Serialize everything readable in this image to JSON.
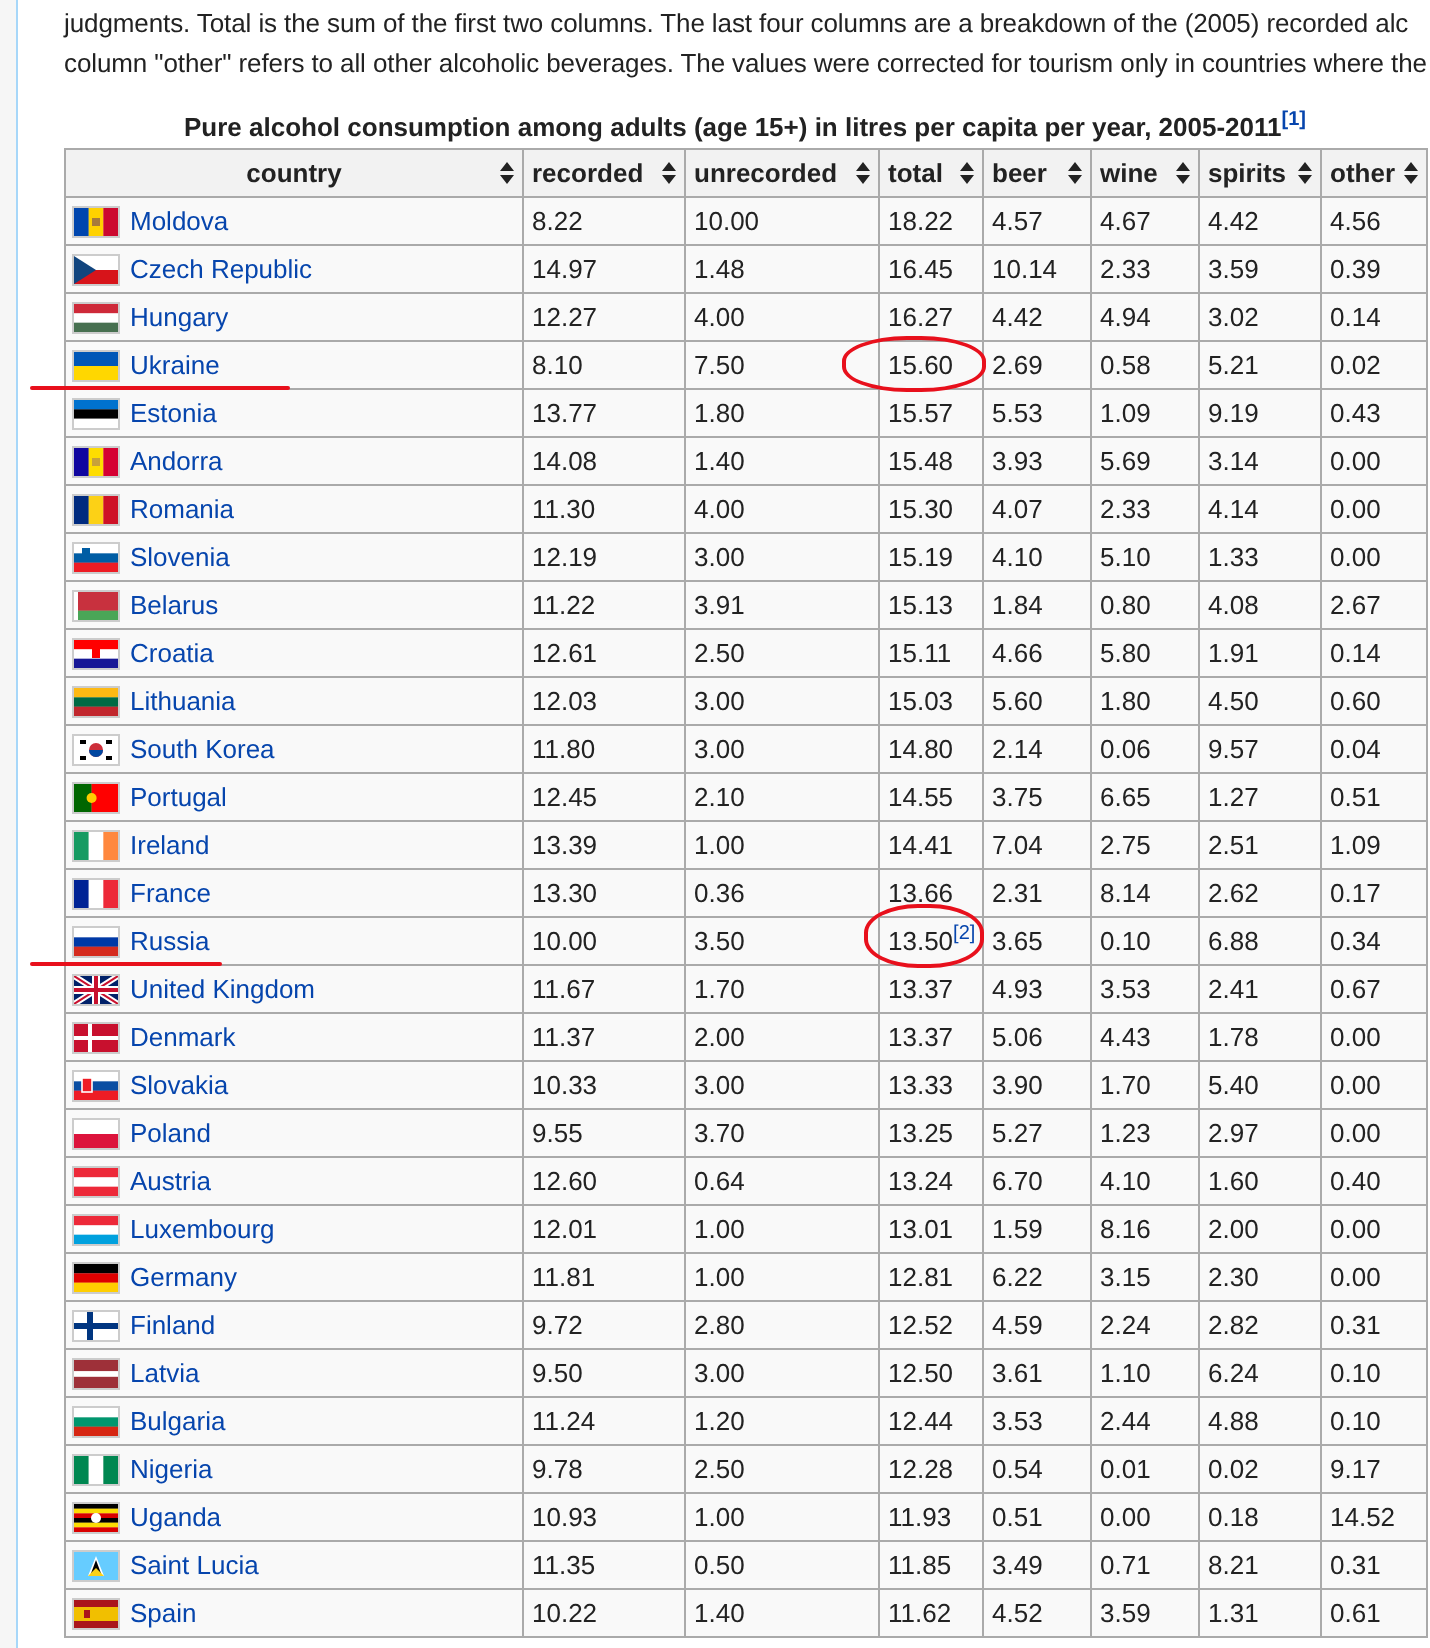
{
  "intro": [
    "judgments. Total is the sum of the first two columns. The last four columns are a breakdown of the (2005) recorded alc",
    "column \"other\" refers to all other alcoholic beverages. The values were corrected for tourism only in countries where the"
  ],
  "table": {
    "caption": "Pure alcohol consumption among adults (age 15+) in litres per capita per year, 2005-2011",
    "caption_note": "[1]",
    "columns": [
      "country",
      "recorded",
      "unrecorded",
      "total",
      "beer",
      "wine",
      "spirits",
      "other"
    ],
    "rows": [
      {
        "country": "Moldova",
        "values": [
          "8.22",
          "10.00",
          "18.22",
          "4.57",
          "4.67",
          "4.42",
          "4.56"
        ],
        "underlined": false,
        "total_circled": false
      },
      {
        "country": "Czech Republic",
        "values": [
          "14.97",
          "1.48",
          "16.45",
          "10.14",
          "2.33",
          "3.59",
          "0.39"
        ],
        "underlined": false,
        "total_circled": false
      },
      {
        "country": "Hungary",
        "values": [
          "12.27",
          "4.00",
          "16.27",
          "4.42",
          "4.94",
          "3.02",
          "0.14"
        ],
        "underlined": false,
        "total_circled": false
      },
      {
        "country": "Ukraine",
        "values": [
          "8.10",
          "7.50",
          "15.60",
          "2.69",
          "0.58",
          "5.21",
          "0.02"
        ],
        "underlined": true,
        "total_circled": true
      },
      {
        "country": "Estonia",
        "values": [
          "13.77",
          "1.80",
          "15.57",
          "5.53",
          "1.09",
          "9.19",
          "0.43"
        ],
        "underlined": false,
        "total_circled": false
      },
      {
        "country": "Andorra",
        "values": [
          "14.08",
          "1.40",
          "15.48",
          "3.93",
          "5.69",
          "3.14",
          "0.00"
        ],
        "underlined": false,
        "total_circled": false
      },
      {
        "country": "Romania",
        "values": [
          "11.30",
          "4.00",
          "15.30",
          "4.07",
          "2.33",
          "4.14",
          "0.00"
        ],
        "underlined": false,
        "total_circled": false
      },
      {
        "country": "Slovenia",
        "values": [
          "12.19",
          "3.00",
          "15.19",
          "4.10",
          "5.10",
          "1.33",
          "0.00"
        ],
        "underlined": false,
        "total_circled": false
      },
      {
        "country": "Belarus",
        "values": [
          "11.22",
          "3.91",
          "15.13",
          "1.84",
          "0.80",
          "4.08",
          "2.67"
        ],
        "underlined": false,
        "total_circled": false
      },
      {
        "country": "Croatia",
        "values": [
          "12.61",
          "2.50",
          "15.11",
          "4.66",
          "5.80",
          "1.91",
          "0.14"
        ],
        "underlined": false,
        "total_circled": false
      },
      {
        "country": "Lithuania",
        "values": [
          "12.03",
          "3.00",
          "15.03",
          "5.60",
          "1.80",
          "4.50",
          "0.60"
        ],
        "underlined": false,
        "total_circled": false
      },
      {
        "country": "South Korea",
        "values": [
          "11.80",
          "3.00",
          "14.80",
          "2.14",
          "0.06",
          "9.57",
          "0.04"
        ],
        "underlined": false,
        "total_circled": false
      },
      {
        "country": "Portugal",
        "values": [
          "12.45",
          "2.10",
          "14.55",
          "3.75",
          "6.65",
          "1.27",
          "0.51"
        ],
        "underlined": false,
        "total_circled": false
      },
      {
        "country": "Ireland",
        "values": [
          "13.39",
          "1.00",
          "14.41",
          "7.04",
          "2.75",
          "2.51",
          "1.09"
        ],
        "underlined": false,
        "total_circled": false
      },
      {
        "country": "France",
        "values": [
          "13.30",
          "0.36",
          "13.66",
          "2.31",
          "8.14",
          "2.62",
          "0.17"
        ],
        "underlined": false,
        "total_circled": false
      },
      {
        "country": "Russia",
        "values": [
          "10.00",
          "3.50",
          "13.50",
          "3.65",
          "0.10",
          "6.88",
          "0.34"
        ],
        "total_note": "[2]",
        "underlined": true,
        "total_circled": true
      },
      {
        "country": "United Kingdom",
        "values": [
          "11.67",
          "1.70",
          "13.37",
          "4.93",
          "3.53",
          "2.41",
          "0.67"
        ],
        "underlined": false,
        "total_circled": false
      },
      {
        "country": "Denmark",
        "values": [
          "11.37",
          "2.00",
          "13.37",
          "5.06",
          "4.43",
          "1.78",
          "0.00"
        ],
        "underlined": false,
        "total_circled": false
      },
      {
        "country": "Slovakia",
        "values": [
          "10.33",
          "3.00",
          "13.33",
          "3.90",
          "1.70",
          "5.40",
          "0.00"
        ],
        "underlined": false,
        "total_circled": false
      },
      {
        "country": "Poland",
        "values": [
          "9.55",
          "3.70",
          "13.25",
          "5.27",
          "1.23",
          "2.97",
          "0.00"
        ],
        "underlined": false,
        "total_circled": false
      },
      {
        "country": "Austria",
        "values": [
          "12.60",
          "0.64",
          "13.24",
          "6.70",
          "4.10",
          "1.60",
          "0.40"
        ],
        "underlined": false,
        "total_circled": false
      },
      {
        "country": "Luxembourg",
        "values": [
          "12.01",
          "1.00",
          "13.01",
          "1.59",
          "8.16",
          "2.00",
          "0.00"
        ],
        "underlined": false,
        "total_circled": false
      },
      {
        "country": "Germany",
        "values": [
          "11.81",
          "1.00",
          "12.81",
          "6.22",
          "3.15",
          "2.30",
          "0.00"
        ],
        "underlined": false,
        "total_circled": false
      },
      {
        "country": "Finland",
        "values": [
          "9.72",
          "2.80",
          "12.52",
          "4.59",
          "2.24",
          "2.82",
          "0.31"
        ],
        "underlined": false,
        "total_circled": false
      },
      {
        "country": "Latvia",
        "values": [
          "9.50",
          "3.00",
          "12.50",
          "3.61",
          "1.10",
          "6.24",
          "0.10"
        ],
        "underlined": false,
        "total_circled": false
      },
      {
        "country": "Bulgaria",
        "values": [
          "11.24",
          "1.20",
          "12.44",
          "3.53",
          "2.44",
          "4.88",
          "0.10"
        ],
        "underlined": false,
        "total_circled": false
      },
      {
        "country": "Nigeria",
        "values": [
          "9.78",
          "2.50",
          "12.28",
          "0.54",
          "0.01",
          "0.02",
          "9.17"
        ],
        "underlined": false,
        "total_circled": false
      },
      {
        "country": "Uganda",
        "values": [
          "10.93",
          "1.00",
          "11.93",
          "0.51",
          "0.00",
          "0.18",
          "14.52"
        ],
        "underlined": false,
        "total_circled": false
      },
      {
        "country": "Saint Lucia",
        "values": [
          "11.35",
          "0.50",
          "11.85",
          "3.49",
          "0.71",
          "8.21",
          "0.31"
        ],
        "underlined": false,
        "total_circled": false
      },
      {
        "country": "Spain",
        "values": [
          "10.22",
          "1.40",
          "11.62",
          "4.52",
          "3.59",
          "1.31",
          "0.61"
        ],
        "underlined": false,
        "total_circled": false
      }
    ]
  }
}
